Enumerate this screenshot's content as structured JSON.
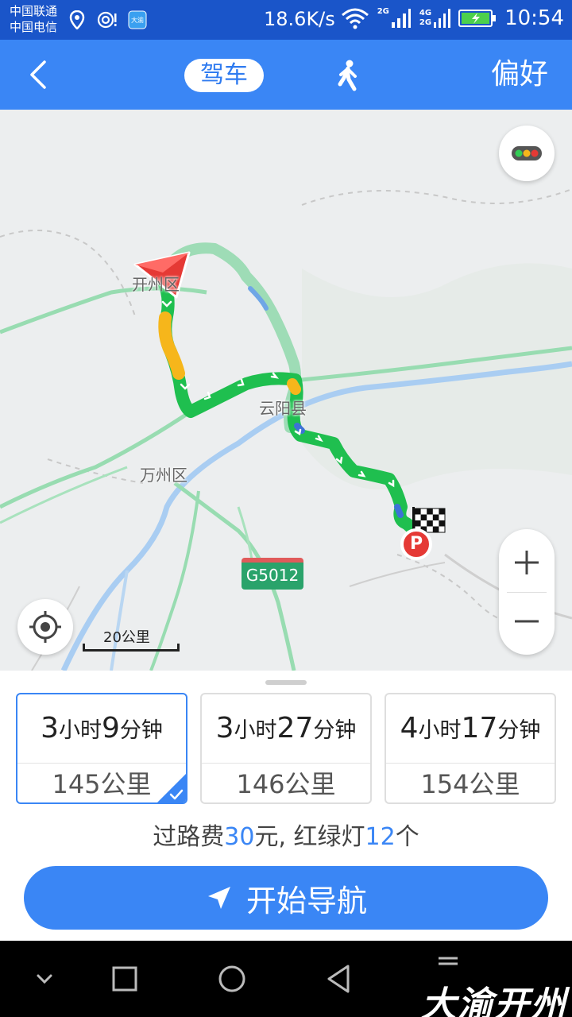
{
  "status_bar": {
    "carrier1": "中国联通",
    "carrier2": "中国电信",
    "net_speed": "18.6K/s",
    "net1": "2G",
    "net2_top": "4G",
    "net2_bottom": "2G",
    "time": "10:54",
    "app_icon_text": "大渝开州"
  },
  "header": {
    "mode_drive": "驾车",
    "preferences": "偏好",
    "icons": [
      "back-icon",
      "walk-icon"
    ]
  },
  "map": {
    "labels": {
      "kaizhou": "开州区",
      "yunyang": "云阳县",
      "wanzhou": "万州区"
    },
    "highway": "G5012",
    "scale": "20公里",
    "destination_marker": "P",
    "route_color": "#1fbf4f",
    "slow_color": "#f6b61b",
    "alt_route_color": "#9edcb6"
  },
  "routes": [
    {
      "hours": "3",
      "hours_unit": "小时",
      "minutes": "9",
      "minutes_unit": "分钟",
      "distance": "145公里",
      "selected": true
    },
    {
      "hours": "3",
      "hours_unit": "小时",
      "minutes": "27",
      "minutes_unit": "分钟",
      "distance": "146公里",
      "selected": false
    },
    {
      "hours": "4",
      "hours_unit": "小时",
      "minutes": "17",
      "minutes_unit": "分钟",
      "distance": "154公里",
      "selected": false
    }
  ],
  "summary": {
    "toll_prefix": "过路费",
    "toll_value": "30",
    "toll_suffix": "元, 红绿灯",
    "lights_value": "12",
    "lights_suffix": "个"
  },
  "start_button": "开始导航",
  "watermark": "大渝开州",
  "accent_color": "#3a86f5"
}
